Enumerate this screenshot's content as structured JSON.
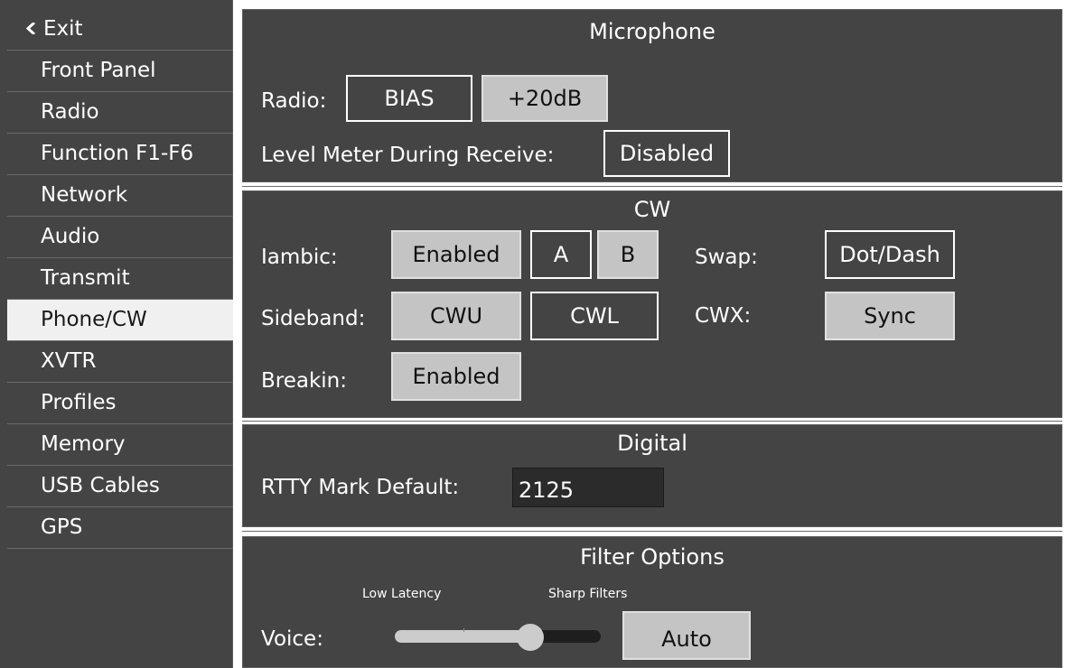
{
  "sidebar": {
    "exit_label": "Exit",
    "items": [
      {
        "label": "Front Panel"
      },
      {
        "label": "Radio"
      },
      {
        "label": "Function F1-F6"
      },
      {
        "label": "Network"
      },
      {
        "label": "Audio"
      },
      {
        "label": "Transmit"
      },
      {
        "label": "Phone/CW",
        "selected": true
      },
      {
        "label": "XVTR"
      },
      {
        "label": "Profiles"
      },
      {
        "label": "Memory"
      },
      {
        "label": "USB Cables"
      },
      {
        "label": "GPS"
      }
    ]
  },
  "microphone": {
    "title": "Microphone",
    "radio_label": "Radio:",
    "bias_label": "BIAS",
    "bias_active": false,
    "gain_label": "+20dB",
    "gain_active": true,
    "level_meter_label": "Level Meter During Receive:",
    "level_meter_value": "Disabled",
    "level_meter_active": false
  },
  "cw": {
    "title": "CW",
    "iambic_label": "Iambic:",
    "iambic_enabled": "Enabled",
    "iambic_a": "A",
    "iambic_b": "B",
    "swap_label": "Swap:",
    "swap_value": "Dot/Dash",
    "sideband_label": "Sideband:",
    "sideband_cwu": "CWU",
    "sideband_cwl": "CWL",
    "cwx_label": "CWX:",
    "cwx_value": "Sync",
    "breakin_label": "Breakin:",
    "breakin_value": "Enabled"
  },
  "digital": {
    "title": "Digital",
    "rtty_label": "RTTY Mark Default:",
    "rtty_value": "2125"
  },
  "filter": {
    "title": "Filter Options",
    "low_latency_label": "Low Latency",
    "sharp_filters_label": "Sharp Filters",
    "voice_label": "Voice:",
    "voice_slider_level": 0.66,
    "auto_label": "Auto"
  },
  "colors": {
    "panel_bg": "#444444",
    "button_on_bg": "#c4c4c4",
    "selected_item_bg": "#f0f0f0",
    "input_bg": "#2b2b2b"
  }
}
